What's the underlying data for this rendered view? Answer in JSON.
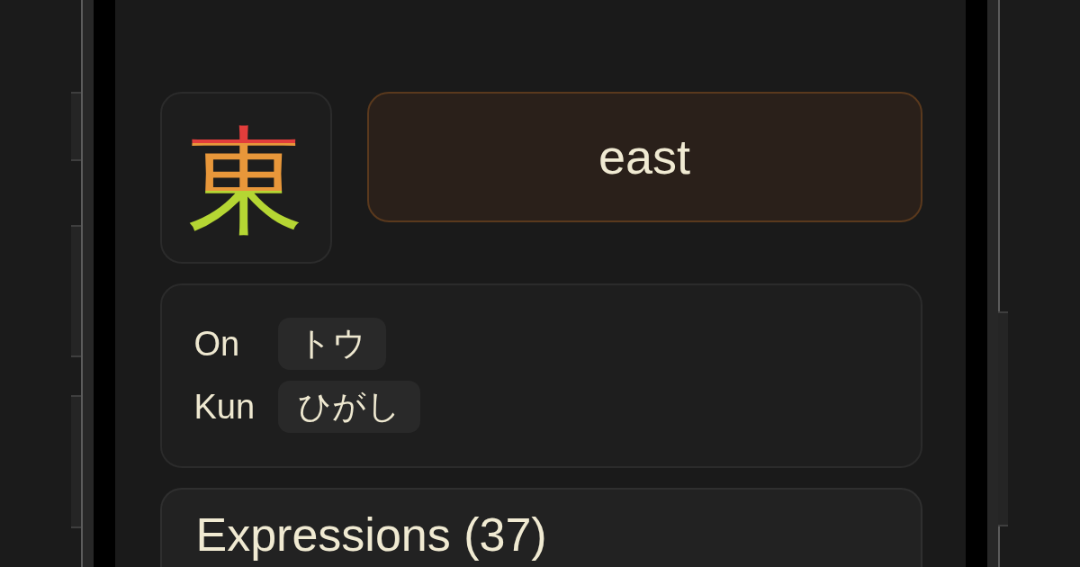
{
  "kanji_tile": {
    "character": "東"
  },
  "meaning_card": {
    "text": "east"
  },
  "readings": [
    {
      "label": "On",
      "values": [
        "トウ"
      ]
    },
    {
      "label": "Kun",
      "values": [
        "ひがし"
      ]
    }
  ],
  "expressions": {
    "title": "Expressions (37)"
  }
}
